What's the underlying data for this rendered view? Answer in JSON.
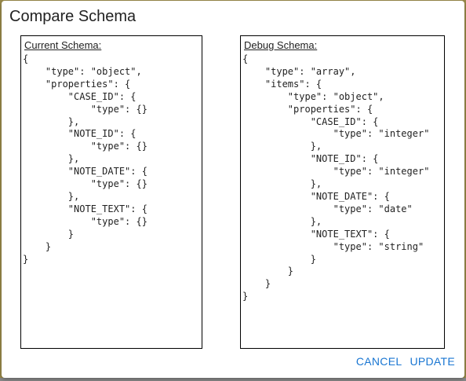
{
  "dialog": {
    "title": "Compare Schema",
    "current": {
      "label": "Current Schema:",
      "code": "{\n    \"type\": \"object\",\n    \"properties\": {\n        \"CASE_ID\": {\n            \"type\": {}\n        },\n        \"NOTE_ID\": {\n            \"type\": {}\n        },\n        \"NOTE_DATE\": {\n            \"type\": {}\n        },\n        \"NOTE_TEXT\": {\n            \"type\": {}\n        }\n    }\n}"
    },
    "debug": {
      "label": "Debug Schema:",
      "code": "{\n    \"type\": \"array\",\n    \"items\": {\n        \"type\": \"object\",\n        \"properties\": {\n            \"CASE_ID\": {\n                \"type\": \"integer\"\n            },\n            \"NOTE_ID\": {\n                \"type\": \"integer\"\n            },\n            \"NOTE_DATE\": {\n                \"type\": \"date\"\n            },\n            \"NOTE_TEXT\": {\n                \"type\": \"string\"\n            }\n        }\n    }\n}"
    },
    "actions": {
      "cancel": "CANCEL",
      "update": "UPDATE"
    },
    "accent_color": "#1976d2"
  }
}
